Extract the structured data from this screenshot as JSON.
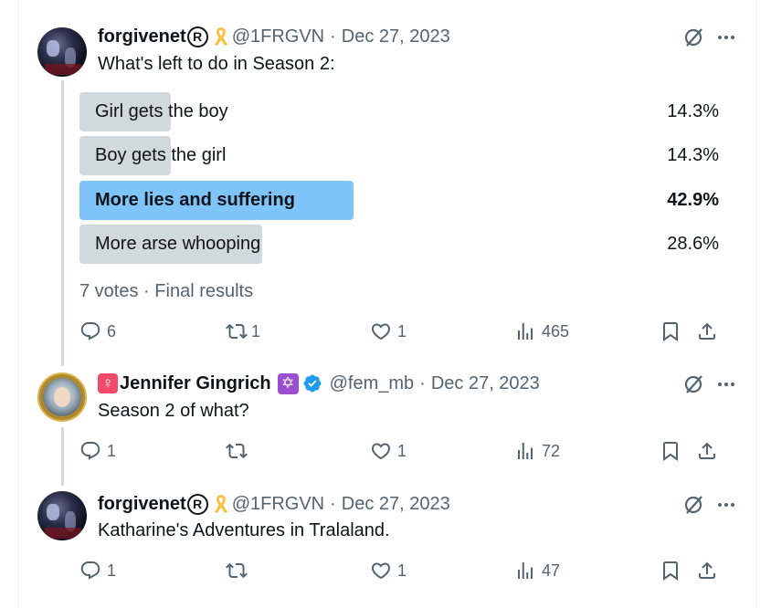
{
  "tweets": [
    {
      "name": "forgivenet",
      "registered_mark": "R",
      "handle": "@1FRGVN",
      "separator": "·",
      "date": "Dec 27, 2023",
      "text": "What's left to do in Season 2:",
      "poll": {
        "options": [
          {
            "label": "Girl gets the boy",
            "percent": "14.3%",
            "share": 0.143,
            "winner": false
          },
          {
            "label": "Boy gets the girl",
            "percent": "14.3%",
            "share": 0.143,
            "winner": false
          },
          {
            "label": "More lies and suffering",
            "percent": "42.9%",
            "share": 0.429,
            "winner": true
          },
          {
            "label": "More arse whooping",
            "percent": "28.6%",
            "share": 0.286,
            "winner": false
          }
        ],
        "votes": "7 votes",
        "separator": "·",
        "status": "Final results"
      },
      "actions": {
        "replies": "6",
        "reposts": "1",
        "likes": "1",
        "views": "465"
      }
    },
    {
      "name_prefix_icon": "female-sign-icon",
      "name": "Jennifer Gingrich",
      "name_suffix_icon": "star-of-david-icon",
      "verified": true,
      "handle": "@fem_mb",
      "separator": "·",
      "date": "Dec 27, 2023",
      "text": "Season 2 of what?",
      "actions": {
        "replies": "1",
        "reposts": "",
        "likes": "1",
        "views": "72"
      }
    },
    {
      "name": "forgivenet",
      "registered_mark": "R",
      "handle": "@1FRGVN",
      "separator": "·",
      "date": "Dec 27, 2023",
      "text": "Katharine's Adventures in Tralaland.",
      "actions": {
        "replies": "1",
        "reposts": "",
        "likes": "1",
        "views": "47"
      }
    }
  ],
  "colors": {
    "text": "#0f1419",
    "secondary": "#536471",
    "poll_bar": "#cfd9de",
    "poll_winner": "#7ec4f8",
    "verified": "#1d9bf0",
    "ribbon": "#f6c244"
  }
}
